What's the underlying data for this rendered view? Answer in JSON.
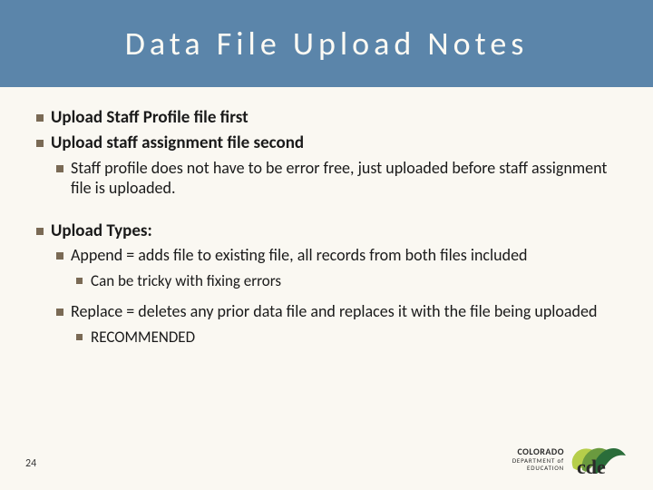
{
  "title": "Data File Upload Notes",
  "bullets": {
    "l1a": "Upload Staff Profile file first",
    "l1b": "Upload staff assignment file second",
    "l2a": "Staff profile does not have to be error free, just uploaded before staff assignment file is uploaded.",
    "l1c": "Upload Types:",
    "l2b": "Append = adds file to existing file, all records from both files included",
    "l3a": "Can be tricky with fixing errors",
    "l2c": "Replace = deletes any prior data file and replaces it with the file being uploaded",
    "l3b": "RECOMMENDED"
  },
  "slide_number": "24",
  "logo": {
    "line1": "COLORADO",
    "line2": "DEPARTMENT of EDUCATION"
  }
}
